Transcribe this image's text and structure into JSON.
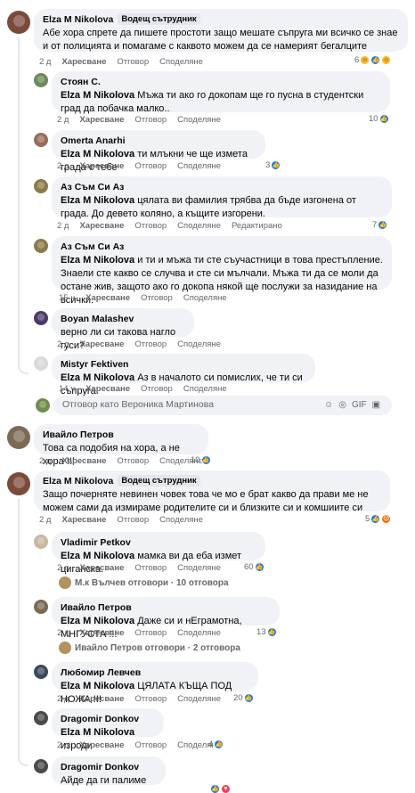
{
  "comments": [
    {
      "author": "Elza M Nikolova",
      "badge": "Водещ сътрудник",
      "text": "Абе хора спрете да пишете простоти защо мешате съпруга ми всичко се знае и от полицията и помагаме с каквото можем да се намерият бегалците",
      "time": "2 д",
      "like": "Харесване",
      "reply": "Отговор",
      "share": "Споделяне",
      "reacts": "6"
    },
    {
      "author": "Стоян С.",
      "mention": "Elza M Nikolova",
      "text": " Мъжа ти ако го докопам ще го пусна в студентски град да побачка малко..",
      "time": "2 д",
      "like": "Харесване",
      "reply": "Отговор",
      "share": "Споделяне",
      "reacts": "10"
    },
    {
      "author": "Omerta Anarhi",
      "mention": "Elza M Nikolova",
      "text": " ти млъкни че ще изметa града с тебе",
      "time": "2 д",
      "like": "Харесване",
      "reply": "Отговор",
      "share": "Споделяне",
      "reacts": "3"
    },
    {
      "author": "Аз Съм Си Аз",
      "mention": "Elza M Nikolova",
      "text": " цялата ви фамилия трябва да бъде изгонена от града. До девето коляно, а къщите изгорени.",
      "time": "2 д",
      "like": "Харесване",
      "reply": "Отговор",
      "share": "Споделяне",
      "edited": "Редактирано",
      "reacts": "7"
    },
    {
      "author": "Аз Съм Си Аз",
      "mention": "Elza M Nikolova",
      "text": " и ти и мъжа ти сте съучастници в това престъпление. Знаели сте какво се случва и сте си мълчали. Мъжа ти да се моли да остане жив, защото ако го докопа някой ще послужи за назидание на всички.",
      "time": "15 ч",
      "like": "Харесване",
      "reply": "Отговор",
      "share": "Споделяне"
    },
    {
      "author": "Boyan Malashev",
      "text": "верно ли си такова нагло гуси?",
      "time": "2 д",
      "like": "Харесване",
      "reply": "Отговор",
      "share": "Споделяне"
    },
    {
      "author": "Mistyr Fektiven",
      "mention": "Elza M Nikolova",
      "text": " Аз в началото си помислих, че ти си съпруга.",
      "time": "14 ч",
      "like": "Харесване",
      "reply": "Отговор",
      "share": "Споделяне"
    },
    {
      "author": "Ивайло Петров",
      "text": "Това са подобия на хора, а не хора !!!",
      "time": "2 д",
      "like": "Харесване",
      "reply": "Отговор",
      "share": "Споделяне",
      "reacts": "10"
    },
    {
      "author": "Elza M Nikolova",
      "badge": "Водещ сътрудник",
      "text": "Защо почерняте невинен човек това че мо е брат какво да прави ме не можем сами да измираме родителите си и близките си и комшиите си",
      "time": "2 д",
      "like": "Харесване",
      "reply": "Отговор",
      "share": "Споделяне",
      "reacts": "5"
    },
    {
      "author": "Vladimir Petkov",
      "mention": "Elza M Nikolova",
      "text": " мамка ви да еба измет циганска.",
      "time": "2 д",
      "like": "Харесване",
      "reply": "Отговор",
      "share": "Споделяне",
      "reacts": "60"
    },
    {
      "author": "Ивайло Петров",
      "mention": "Elza M Nikolova",
      "text": " Даже си и нЕграмотна, МНГУСТА !!!",
      "time": "2 д",
      "like": "Харесване",
      "reply": "Отговор",
      "share": "Споделяне",
      "reacts": "13"
    },
    {
      "author": "Любомир Левчев",
      "mention": "Elza M Nikolova",
      "text": " ЦЯЛАТА КЪЩА ПОД НОЖА !!!",
      "time": "2 д",
      "like": "Харесване",
      "reply": "Отговор",
      "share": "Споделяне",
      "reacts": "20"
    },
    {
      "author": "Dragomir Donkov",
      "mention": "Elza M Nikolova",
      "text": " изроди",
      "time": "2 д",
      "like": "Харесване",
      "reply": "Отговор",
      "share": "Споделяне",
      "reacts": "4"
    },
    {
      "author": "Dragomir Donkov",
      "text": "Айде да ги палиме"
    }
  ],
  "reply_box": {
    "placeholder": "Отговор като Вероника Мартинова"
  },
  "reply_threads": [
    {
      "text": "М.к Вълчев отговори · 10 отговора"
    },
    {
      "text": "Ивайло Петров отговори · 2 отговора"
    }
  ],
  "reply_icons": [
    "☺",
    "◎",
    "GIF",
    "▣"
  ],
  "colors": {
    "bubble": "#f0f2f5",
    "muted": "#65676b",
    "accent": "#1877f2"
  }
}
